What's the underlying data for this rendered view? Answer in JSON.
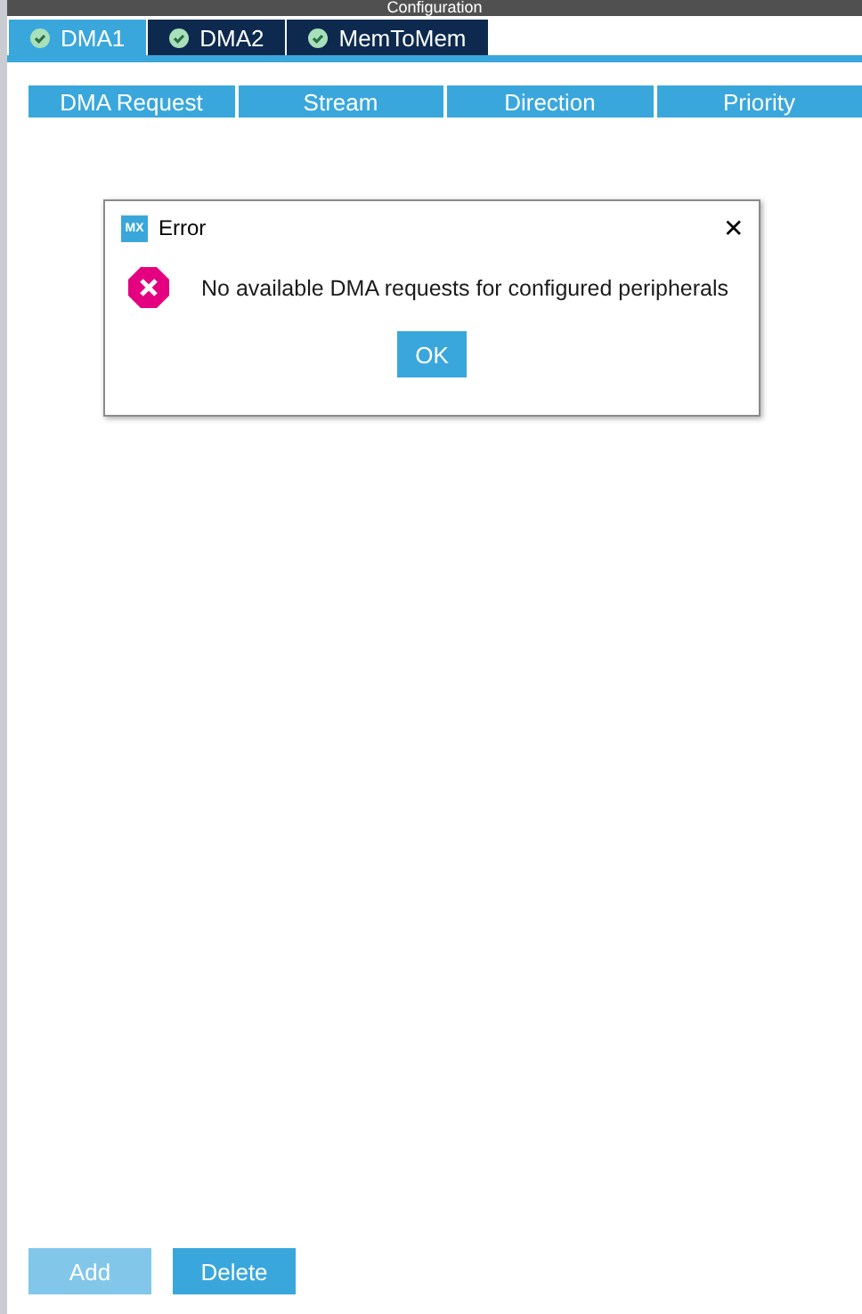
{
  "header": {
    "title": "Configuration"
  },
  "tabs": [
    {
      "label": "DMA1",
      "selected": true
    },
    {
      "label": "DMA2",
      "selected": false
    },
    {
      "label": "MemToMem",
      "selected": false
    }
  ],
  "table": {
    "columns": [
      "DMA Request",
      "Stream",
      "Direction",
      "Priority"
    ]
  },
  "buttons": [
    {
      "label": "Add",
      "disabled": true
    },
    {
      "label": "Delete",
      "disabled": false
    }
  ],
  "dialog": {
    "logo": "MX",
    "title": "Error",
    "close": "✕",
    "message": "No available DMA requests for configured peripherals",
    "button": "OK"
  }
}
